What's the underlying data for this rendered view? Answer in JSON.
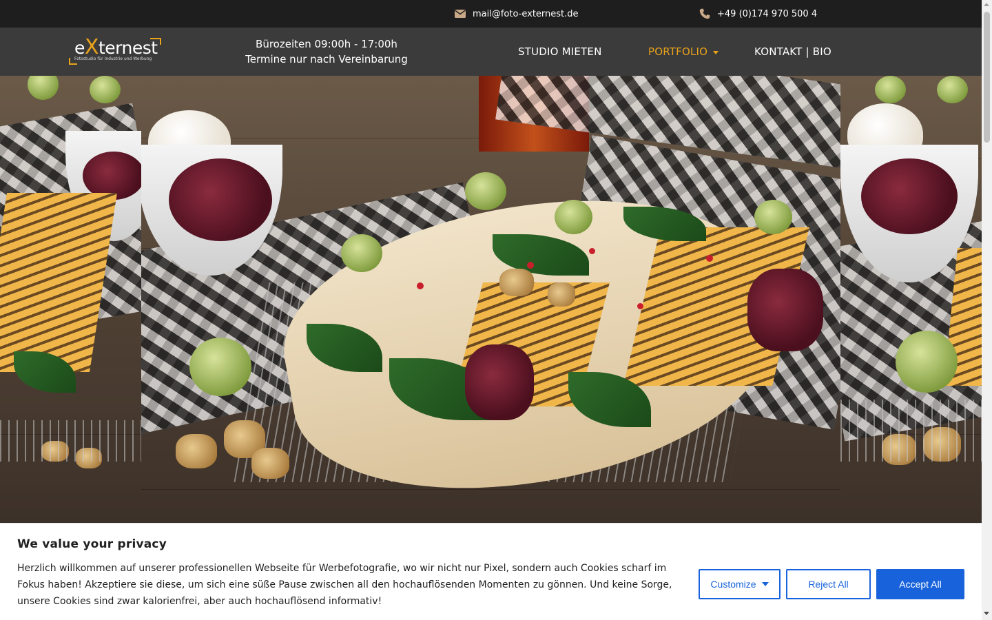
{
  "topbar": {
    "email": "mail@foto-externest.de",
    "email_icon": "envelope-icon",
    "phone": "+49 (0)174 970 500 4",
    "phone_icon": "phone-icon"
  },
  "header": {
    "logo": {
      "brand": "eXternest",
      "tagline": "Fotostudio für Industrie und Werbung"
    },
    "hours_line1": "Bürozeiten 09:00h - 17:00h",
    "hours_line2": "Termine nur nach Vereinbarung",
    "nav": {
      "studio": "STUDIO MIETEN",
      "portfolio": "PORTFOLIO",
      "kontakt": "KONTAKT | BIO"
    },
    "accent_color": "#e9a31b"
  },
  "hero": {
    "alt_description_visible": false
  },
  "cookie": {
    "title": "We value your privacy",
    "text": "Herzlich willkommen auf unserer professionellen Webseite für Werbefotografie, wo wir nicht nur Pixel, sondern auch Cookies scharf im Fokus haben! Akzeptiere sie diese, um sich eine süße Pause zwischen all den hochauflösenden Momenten zu gönnen. Und keine Sorge, unsere Cookies sind zwar kalorienfrei, aber auch hochauflösend informativ!",
    "customize_label": "Customize",
    "reject_label": "Reject All",
    "accept_label": "Accept All",
    "button_color": "#1863dc"
  }
}
